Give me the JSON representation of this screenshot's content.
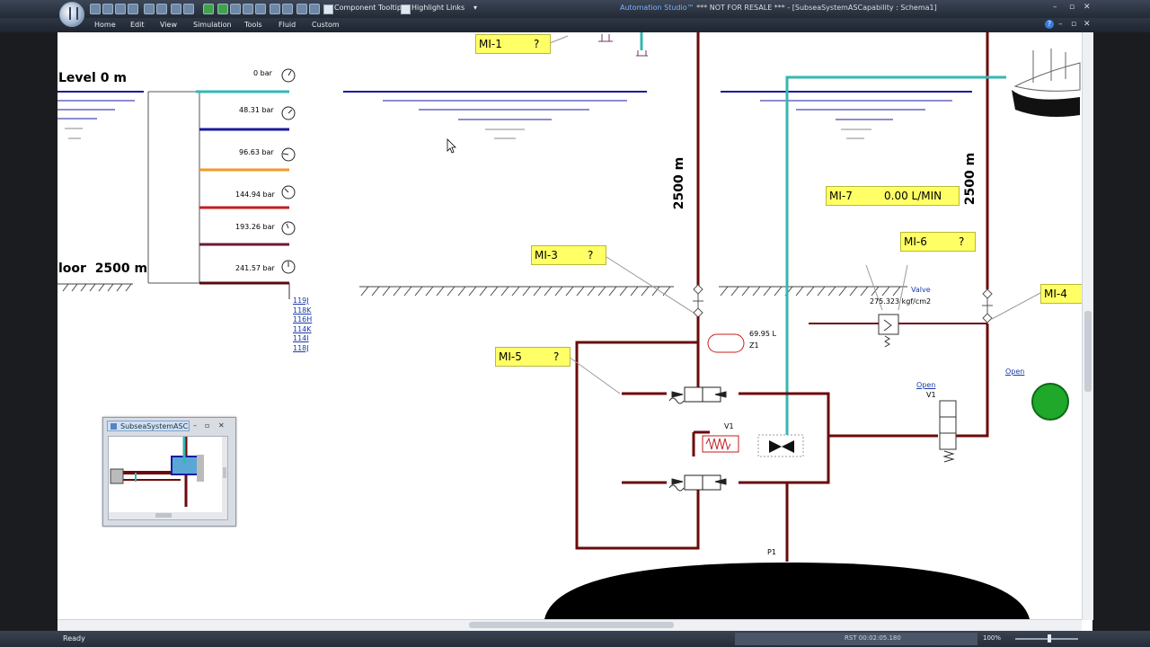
{
  "window": {
    "title_brand": "Automation Studio™",
    "title_rest": " *** NOT FOR RESALE ***  - [SubseaSystemASCapability : Schema1]",
    "controls": [
      "–",
      "▫",
      "✕"
    ]
  },
  "quick_access": {
    "component_tooltip": "Component Tooltip",
    "highlight_links": "Highlight Links"
  },
  "menu": [
    "Home",
    "Edit",
    "View",
    "Simulation",
    "Tools",
    "Fluid",
    "Custom"
  ],
  "help": "?",
  "mini_window": {
    "title": "SubseaSystemASCa...",
    "controls": [
      "–",
      "▫",
      "✕"
    ]
  },
  "schematic": {
    "level_top": "Level 0 m",
    "level_bottom": "loor  2500 m",
    "depth_left": "2500 m",
    "depth_right": "2500 m",
    "gauges": [
      "0 bar",
      "48.31 bar",
      "96.63 bar",
      "144.94 bar",
      "193.26 bar",
      "241.57 bar"
    ],
    "links": [
      "119J",
      "118K",
      "116H",
      "114K",
      "114I",
      "118J"
    ],
    "tags": {
      "mi1": {
        "name": "MI-1",
        "value": "?"
      },
      "mi3": {
        "name": "MI-3",
        "value": "?"
      },
      "mi4": {
        "name": "MI-4",
        "value": ""
      },
      "mi5": {
        "name": "MI-5",
        "value": "?"
      },
      "mi6": {
        "name": "MI-6",
        "value": "?"
      },
      "mi7": {
        "name": "MI-7",
        "value": "0.00 L/MIN"
      }
    },
    "accumulator_volume": "69.95 L",
    "accumulator_label": "Z1",
    "valve_v1_label": "V1",
    "valve_v1_right_label": "V1",
    "open_link_1": "Open",
    "open_link_2": "Open",
    "relief_label": "Valve",
    "relief_value": "275.323 kgf/cm2",
    "pump_label": "P1"
  },
  "status": {
    "left": "Ready",
    "time": "RST 00:02:05.180",
    "zoom": "100%"
  },
  "colors": {
    "pipe_dark_red": "#6b0a0a",
    "pipe_teal": "#35b7b3",
    "pipe_blue": "#1a1aa0",
    "tag_yellow": "#ffff66",
    "indicator_green": "#1fa82a"
  }
}
